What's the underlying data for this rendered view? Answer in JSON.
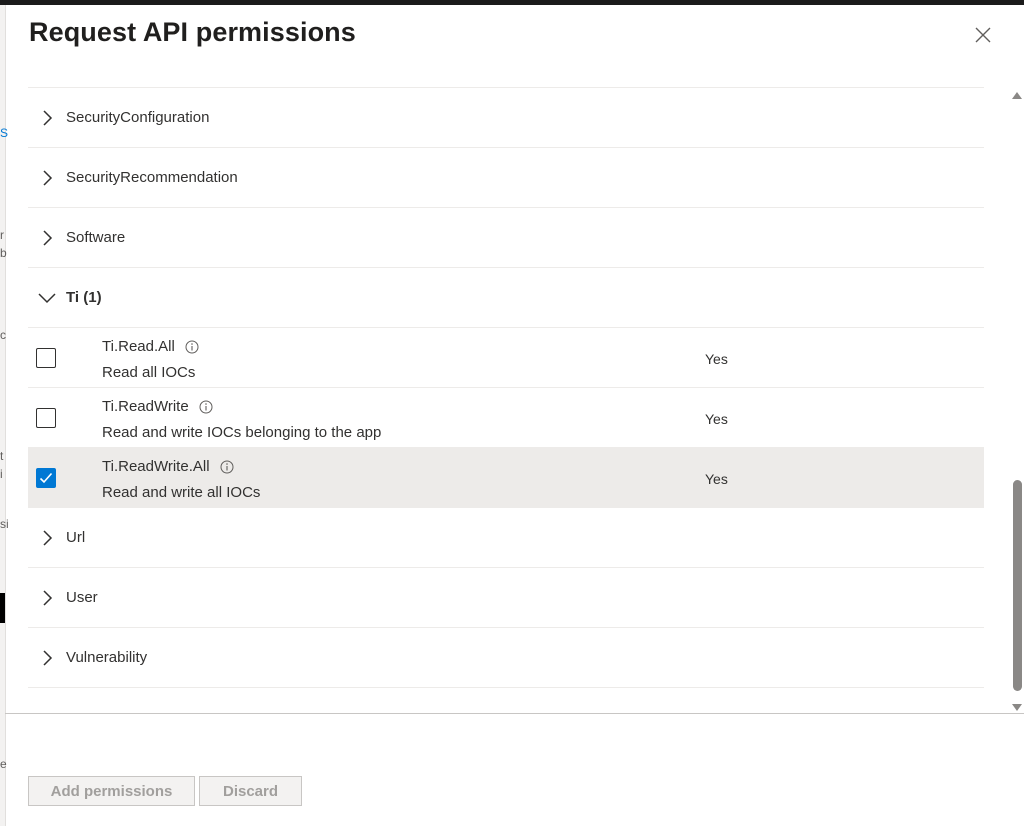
{
  "panel": {
    "title": "Request API permissions",
    "close_icon": "close-icon"
  },
  "groups_before": [
    {
      "label": "SecurityConfiguration"
    },
    {
      "label": "SecurityRecommendation"
    },
    {
      "label": "Software"
    }
  ],
  "expanded_group": {
    "label": "Ti (1)",
    "permissions": [
      {
        "name": "Ti.Read.All",
        "description": "Read all IOCs",
        "admin_consent": "Yes",
        "checked": false
      },
      {
        "name": "Ti.ReadWrite",
        "description": "Read and write IOCs belonging to the app",
        "admin_consent": "Yes",
        "checked": false
      },
      {
        "name": "Ti.ReadWrite.All",
        "description": "Read and write all IOCs",
        "admin_consent": "Yes",
        "checked": true
      }
    ]
  },
  "groups_after": [
    {
      "label": "Url"
    },
    {
      "label": "User"
    },
    {
      "label": "Vulnerability"
    }
  ],
  "footer": {
    "add_label": "Add permissions",
    "discard_label": "Discard"
  },
  "background_fragments": [
    "S",
    "r",
    "b",
    "c",
    "t",
    "i",
    "si",
    "e"
  ],
  "colors": {
    "accent": "#0078d4",
    "selected_row": "#edebe9",
    "disabled_text": "#a19f9d"
  }
}
